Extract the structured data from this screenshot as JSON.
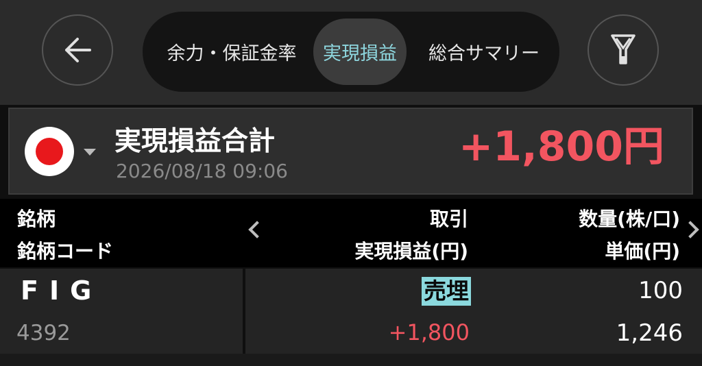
{
  "header": {
    "back_icon": "arrow-left-icon",
    "filter_icon": "filter-funnel-icon",
    "tabs": [
      {
        "label": "余力・保証金率",
        "active": false
      },
      {
        "label": "実現損益",
        "active": true
      },
      {
        "label": "総合サマリー",
        "active": false
      }
    ]
  },
  "summary": {
    "market_flag": "japan-flag-icon",
    "title": "実現損益合計",
    "datetime": "2026/08/18 09:06",
    "total": "+1,800円"
  },
  "columns": {
    "name": "銘柄",
    "code": "銘柄コード",
    "trade": "取引",
    "realized_pl": "実現損益(円)",
    "quantity": "数量(株/口)",
    "unit_price": "単価(円)"
  },
  "rows": [
    {
      "name": "FIG",
      "code": "4392",
      "trade": "売埋",
      "realized_pl": "+1,800",
      "quantity": "100",
      "unit_price": "1,246"
    }
  ],
  "colors": {
    "accent_teal": "#8ed6de",
    "profit_red": "#f25560",
    "trade_badge": "#8bd9de"
  }
}
